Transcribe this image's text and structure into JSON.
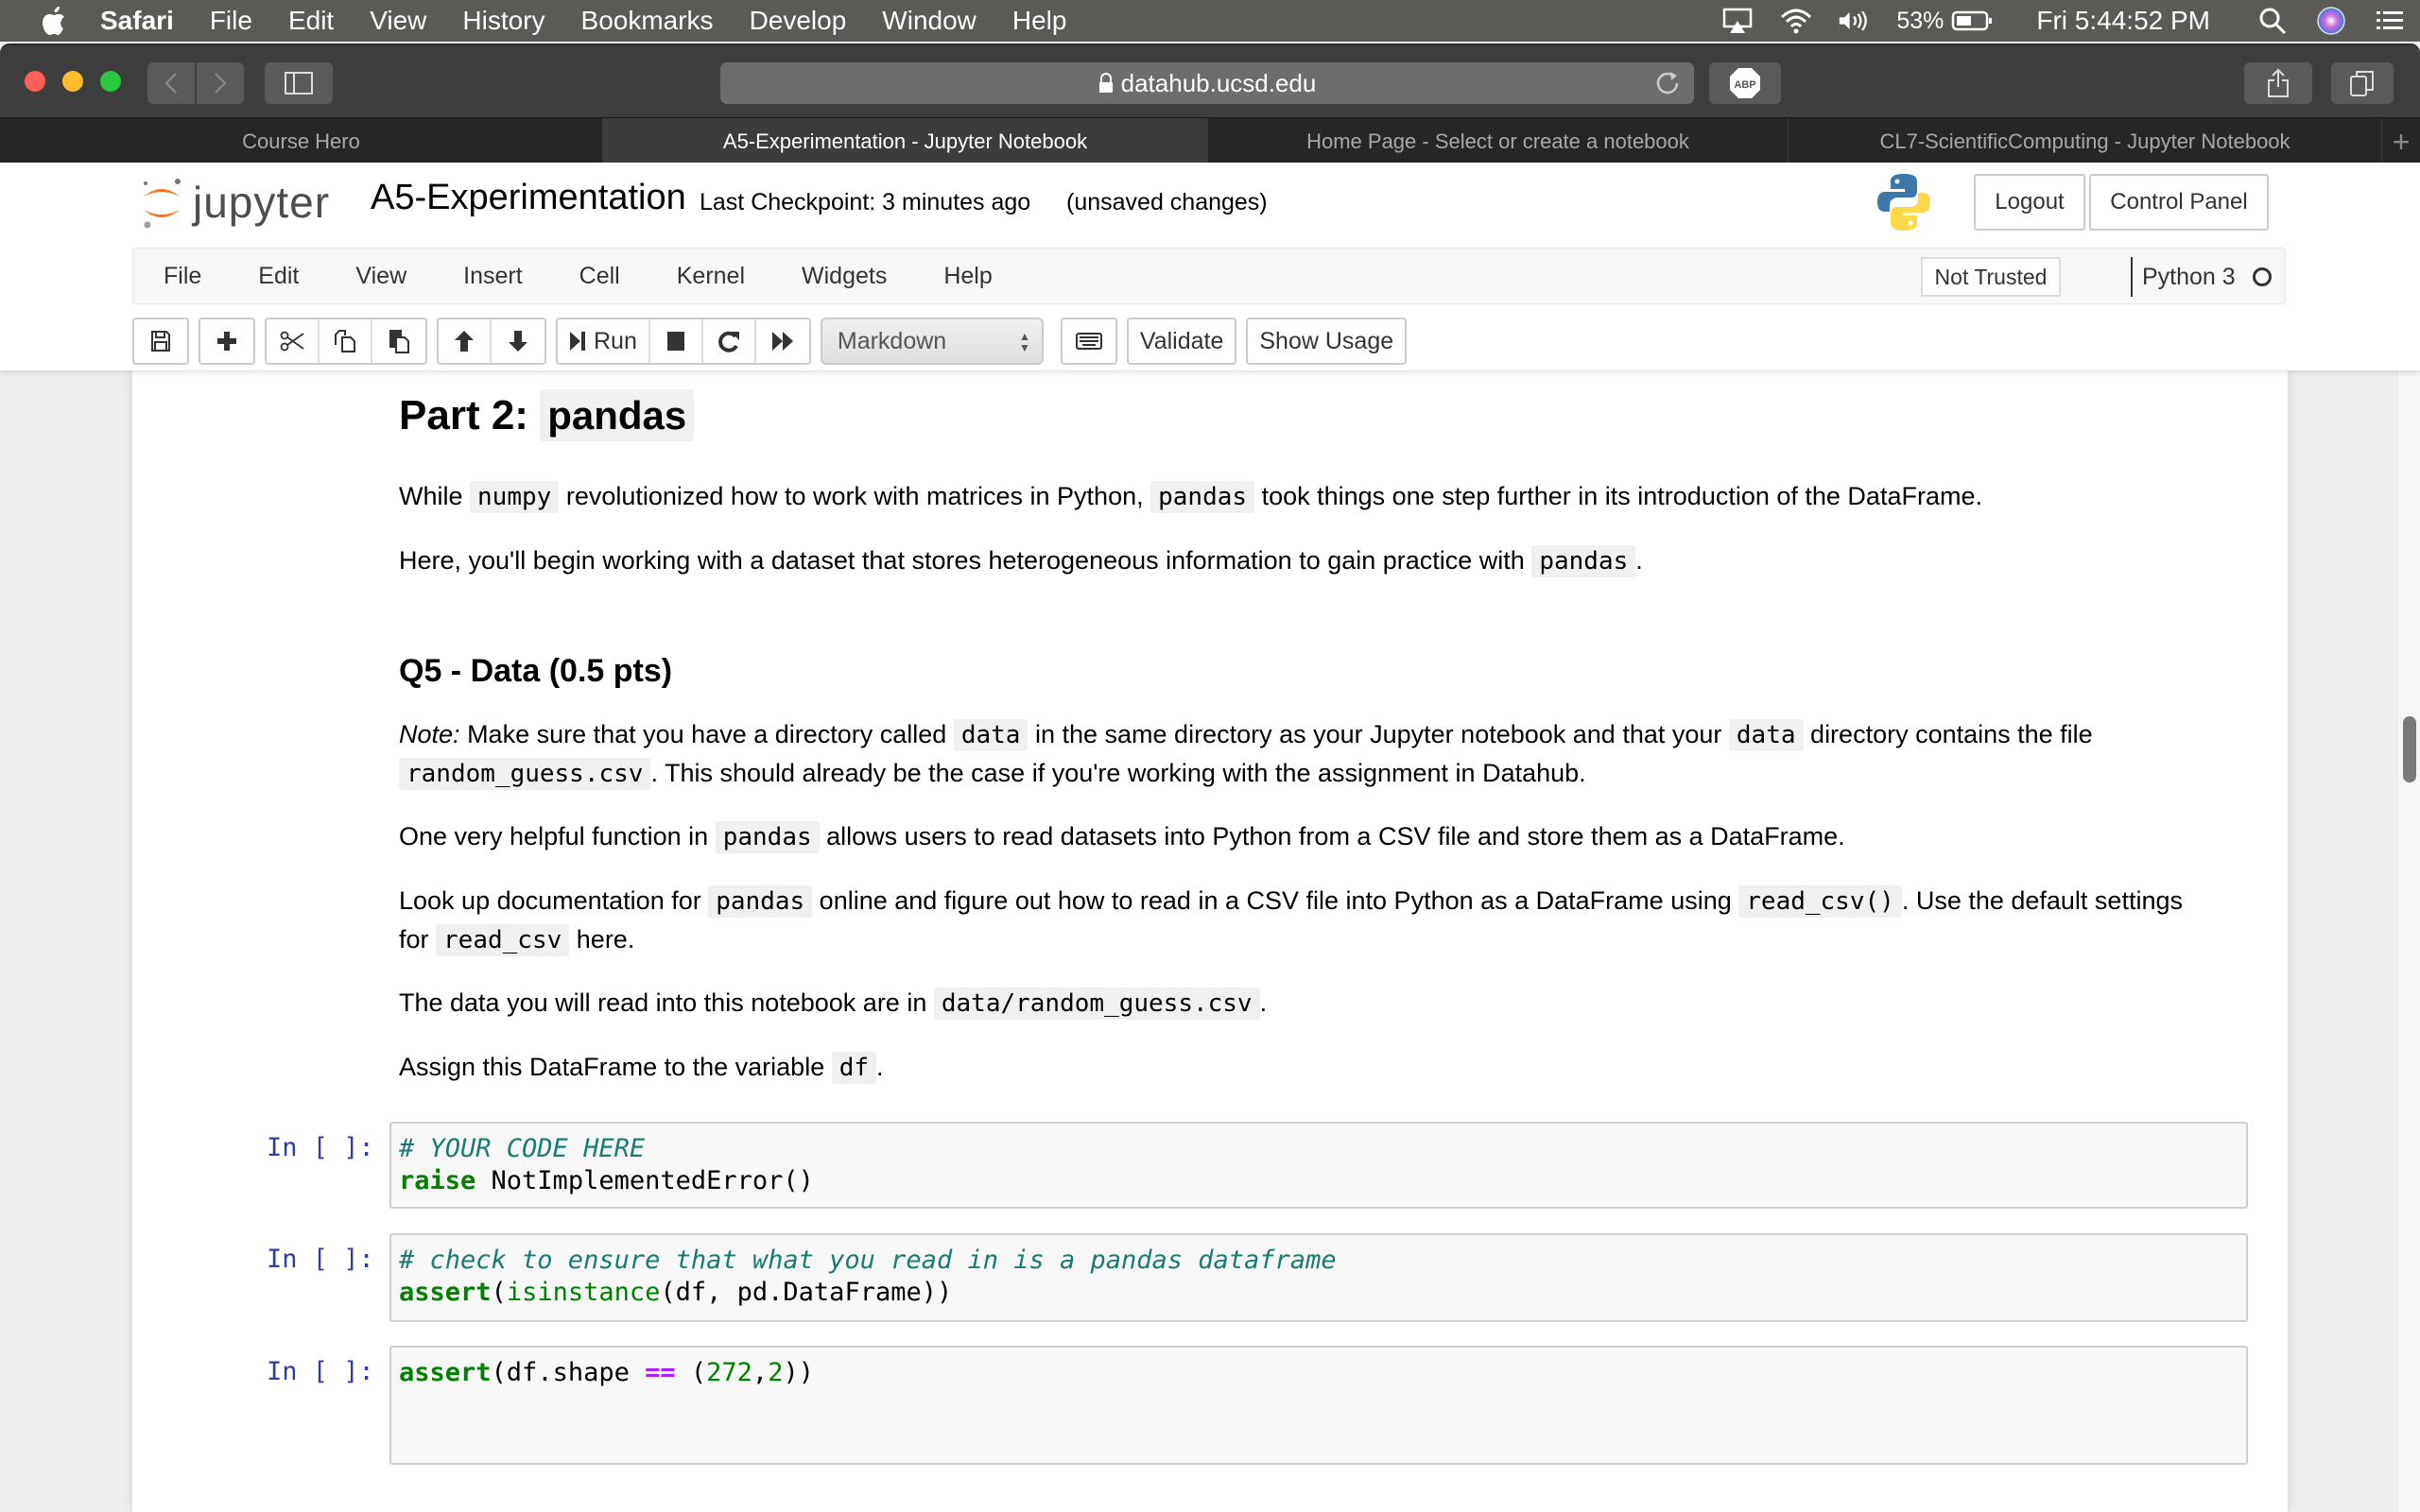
{
  "os_menubar": {
    "app": "Safari",
    "items": [
      "File",
      "Edit",
      "View",
      "History",
      "Bookmarks",
      "Develop",
      "Window",
      "Help"
    ],
    "battery": "53%",
    "clock": "Fri 5:44:52 PM"
  },
  "browser": {
    "url": "datahub.ucsd.edu",
    "adblock_label": "ABP",
    "tabs": [
      {
        "label": "Course Hero",
        "active": false
      },
      {
        "label": "A5-Experimentation - Jupyter Notebook",
        "active": true
      },
      {
        "label": "Home Page - Select or create a notebook",
        "active": false
      },
      {
        "label": "CL7-ScientificComputing - Jupyter Notebook",
        "active": false
      }
    ],
    "new_tab": "+"
  },
  "jupyter": {
    "logo_text": "jupyter",
    "notebook_name": "A5-Experimentation",
    "checkpoint": "Last Checkpoint: 3 minutes ago",
    "unsaved": "(unsaved changes)",
    "logout_label": "Logout",
    "control_panel_label": "Control Panel",
    "menu": [
      "File",
      "Edit",
      "View",
      "Insert",
      "Cell",
      "Kernel",
      "Widgets",
      "Help"
    ],
    "trust_label": "Not Trusted",
    "kernel_label": "Python 3",
    "toolbar": {
      "run_label": "Run",
      "cell_type": "Markdown",
      "validate_label": "Validate",
      "show_usage_label": "Show Usage"
    }
  },
  "content": {
    "part_heading_prefix": "Part 2:",
    "part_heading_code": "pandas",
    "p1": {
      "t1": "While",
      "c1": "numpy",
      "t2": "revolutionized how to work with matrices in Python,",
      "c2": "pandas",
      "t3": "took things one step further in its introduction of the DataFrame."
    },
    "p2": {
      "t1": "Here, you'll begin working with a dataset that stores heterogeneous information to gain practice with",
      "c1": "pandas",
      "t2": "."
    },
    "q5_heading": "Q5 - Data (0.5 pts)",
    "p3": {
      "em": "Note:",
      "t1": "Make sure that you have a directory called",
      "c1": "data",
      "t2": "in the same directory as your Jupyter notebook and that your",
      "c2": "data",
      "t3": "directory contains the file",
      "c3": "random_guess.csv",
      "t4": ". This should already be the case if you're working with the assignment in Datahub."
    },
    "p4": {
      "t1": "One very helpful function in",
      "c1": "pandas",
      "t2": "allows users to read datasets into Python from a CSV file and store them as a DataFrame."
    },
    "p5": {
      "t1": "Look up documentation for",
      "c1": "pandas",
      "t2": "online and figure out how to read in a CSV file into Python as a DataFrame using",
      "c2": "read_csv()",
      "t3": ". Use the default settings for",
      "c3": "read_csv",
      "t4": "here."
    },
    "p6": {
      "t1": "The data you will read into this notebook are in",
      "c1": "data/random_guess.csv",
      "t2": "."
    },
    "p7": {
      "t1": "Assign this DataFrame to the variable",
      "c1": "df",
      "t2": "."
    }
  },
  "cells": [
    {
      "prompt": "In [ ]:",
      "line1_comment": "# YOUR CODE HERE",
      "line2_kw": "raise",
      "line2_rest": " NotImplementedError()"
    },
    {
      "prompt": "In [ ]:",
      "line1_comment": "# check to ensure that what you read in is a pandas dataframe",
      "line2_kw": "assert",
      "line2_p1": "(",
      "line2_builtin": "isinstance",
      "line2_rest": "(df, pd.DataFrame))"
    },
    {
      "prompt": "In [ ]:",
      "line1_kw": "assert",
      "line1_p1": "(df.shape ",
      "line1_op": "==",
      "line1_p2": " (",
      "line1_num1": "272",
      "line1_p3": ",",
      "line1_num2": "2",
      "line1_p4": "))"
    }
  ]
}
